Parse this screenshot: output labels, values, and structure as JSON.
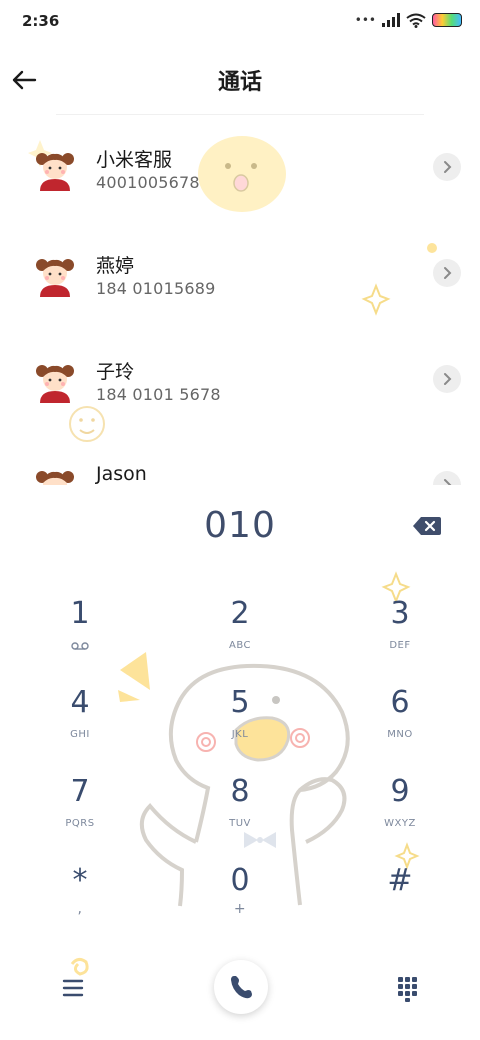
{
  "status_bar": {
    "time": "2:36",
    "signal_dots": "•••"
  },
  "header": {
    "title": "通话"
  },
  "contacts": [
    {
      "name": "小米客服",
      "number": "4001005678"
    },
    {
      "name": "燕婷",
      "number": "184 01015689"
    },
    {
      "name": "子玲",
      "number": "184 0101 5678"
    },
    {
      "name": "Jason",
      "number": ""
    }
  ],
  "dialer": {
    "input": "010"
  },
  "keypad": [
    {
      "digit": "1",
      "letters": "oo"
    },
    {
      "digit": "2",
      "letters": "ABC"
    },
    {
      "digit": "3",
      "letters": "DEF"
    },
    {
      "digit": "4",
      "letters": "GHI"
    },
    {
      "digit": "5",
      "letters": "JKL"
    },
    {
      "digit": "6",
      "letters": "MNO"
    },
    {
      "digit": "7",
      "letters": "PQRS"
    },
    {
      "digit": "8",
      "letters": "TUV"
    },
    {
      "digit": "9",
      "letters": "WXYZ"
    },
    {
      "digit": "*",
      "letters": ","
    },
    {
      "digit": "0",
      "letters": "+"
    },
    {
      "digit": "#",
      "letters": ""
    }
  ],
  "colors": {
    "accent": "#3a4c6e",
    "deco_yellow": "#ffe9a8",
    "muted": "#7d889c"
  },
  "icons": {
    "back": "arrow-left-icon",
    "chevron": "chevron-right-icon",
    "backspace": "backspace-icon",
    "menu": "hamburger-menu-icon",
    "call": "phone-icon",
    "keypad": "dialpad-icon"
  }
}
